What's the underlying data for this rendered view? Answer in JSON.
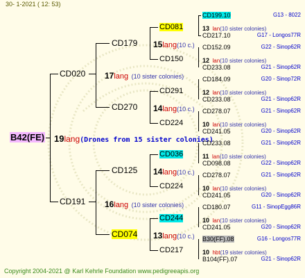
{
  "header": "30-   1-2021  ( 12: 53)",
  "footer": "Copyright 2004-2021 @ Karl Kehrle Foundation    www.pedigreeapis.org",
  "root": {
    "name": "B42(FE)",
    "count": "19",
    "lang": "lang",
    "note": "(Drones from 15 sister colonies)"
  },
  "gen1": [
    {
      "name": "CD020",
      "count": "17",
      "lang": "lang",
      "note": "(10 sister colonies)"
    },
    {
      "name": "CD191",
      "count": "16",
      "lang": "lang",
      "note": "(10 sister colonies)"
    }
  ],
  "gen2": [
    {
      "name": "CD179",
      "count": "15",
      "lang": "lang",
      "note": "(10 c.)"
    },
    {
      "name": "CD270",
      "count": "14",
      "lang": "lang",
      "note": "(10 c.)"
    },
    {
      "name": "CD125",
      "count": "14",
      "lang": "lang",
      "note": "(10 c.)"
    },
    {
      "name": "CD074",
      "count": "13",
      "lang": "lang",
      "note": "(10 c.)"
    }
  ],
  "gen3": [
    {
      "name": "CD081",
      "count": "13",
      "lang": "lan",
      "note": "(10 sister colonies)"
    },
    {
      "name": "CD150",
      "count": "12",
      "lang": "lan",
      "note": "(10 sister colonies)"
    },
    {
      "name": "CD291",
      "count": "12",
      "lang": "lan",
      "note": "(10 sister colonies)"
    },
    {
      "name": "CD224",
      "count": "10",
      "lang": "lan",
      "note": "(10 sister colonies)"
    },
    {
      "name": "CD036",
      "count": "11",
      "lang": "lan",
      "note": "(10 sister colonies)"
    },
    {
      "name": "CD224",
      "count": "10",
      "lang": "lan",
      "note": "(10 sister colonies)"
    },
    {
      "name": "CD244",
      "count": "10",
      "lang": "lan",
      "note": "(10 sister colonies)"
    },
    {
      "name": "CD217",
      "count": "10",
      "lang": "hbt",
      "note": "(19 sister colonies)"
    }
  ],
  "gen4": [
    {
      "name": "CD199.10",
      "origin": "G13 - 8022"
    },
    {
      "name": "CD217.10",
      "origin": "G17 - Longos77R"
    },
    {
      "name": "CD152.09",
      "origin": "G22 - Sinop62R"
    },
    {
      "name": "CD233.08",
      "origin": "G21 - Sinop62R"
    },
    {
      "name": "CD184.09",
      "origin": "G20 - Sinop72R"
    },
    {
      "name": "CD233.08",
      "origin": "G21 - Sinop62R"
    },
    {
      "name": "CD278.07",
      "origin": "G21 - Sinop62R"
    },
    {
      "name": "CD241.05",
      "origin": "G20 - Sinop62R"
    },
    {
      "name": "CD233.08",
      "origin": "G21 - Sinop62R"
    },
    {
      "name": "CD098.08",
      "origin": "G22 - Sinop62R"
    },
    {
      "name": "CD278.07",
      "origin": "G21 - Sinop62R"
    },
    {
      "name": "CD241.05",
      "origin": "G20 - Sinop62R"
    },
    {
      "name": "CD180.07",
      "origin": "G11 - SinopEgg86R"
    },
    {
      "name": "CD241.05",
      "origin": "G20 - Sinop62R"
    },
    {
      "name": "B30(FF).08",
      "origin": "G16 - Longos77R"
    },
    {
      "name": "B104(FF).07",
      "origin": "G21 - Sinop62R"
    }
  ]
}
